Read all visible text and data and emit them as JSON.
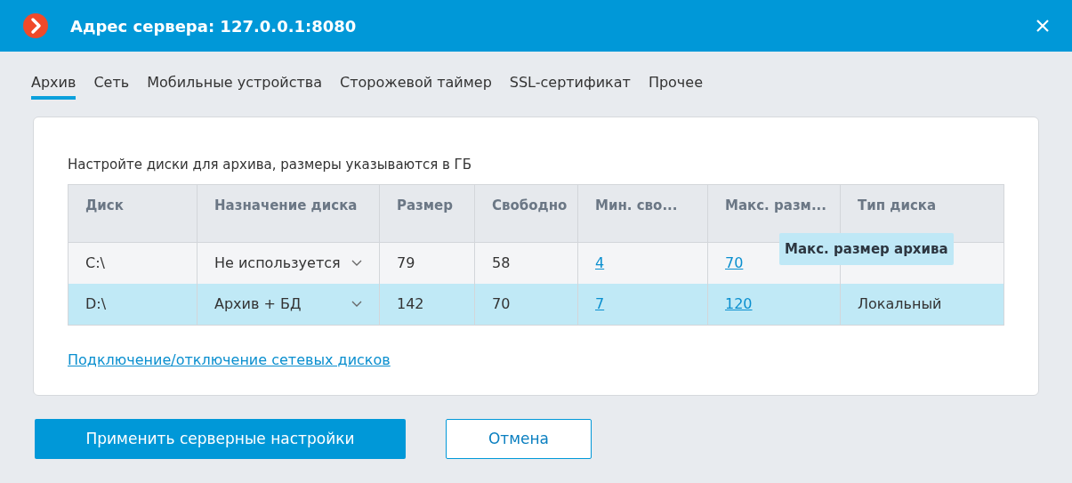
{
  "window": {
    "title": "Адрес сервера: 127.0.0.1:8080"
  },
  "tabs": [
    {
      "label": "Архив",
      "selected": true
    },
    {
      "label": "Сеть",
      "selected": false
    },
    {
      "label": "Мобильные устройства",
      "selected": false
    },
    {
      "label": "Сторожевой таймер",
      "selected": false
    },
    {
      "label": "SSL-сертификат",
      "selected": false
    },
    {
      "label": "Прочее",
      "selected": false
    }
  ],
  "instruction": "Настройте диски для архива, размеры указываются в ГБ",
  "table": {
    "columns": [
      {
        "label": "Диск",
        "kind": "text"
      },
      {
        "label": "Назначение диска",
        "kind": "dropdown"
      },
      {
        "label": "Размер",
        "kind": "text"
      },
      {
        "label": "Свободно",
        "kind": "text"
      },
      {
        "label": "Мин. сво...",
        "kind": "link"
      },
      {
        "label": "Макс. разм...",
        "kind": "link"
      },
      {
        "label": "Тип диска",
        "kind": "text"
      }
    ],
    "rows": [
      {
        "selected": false,
        "cells": [
          "C:\\",
          "Не используется",
          "79",
          "58",
          "4",
          "70",
          null
        ]
      },
      {
        "selected": true,
        "cells": [
          "D:\\",
          "Архив + БД",
          "142",
          "70",
          "7",
          "120",
          "Локальный"
        ]
      }
    ]
  },
  "tooltip": "Макс. размер архива",
  "network_link": "Подключение/отключение сетевых дисков",
  "buttons": [
    {
      "label": "Применить серверные настройки",
      "kind": "primary"
    },
    {
      "label": "Отмена",
      "kind": "secondary"
    }
  ]
}
